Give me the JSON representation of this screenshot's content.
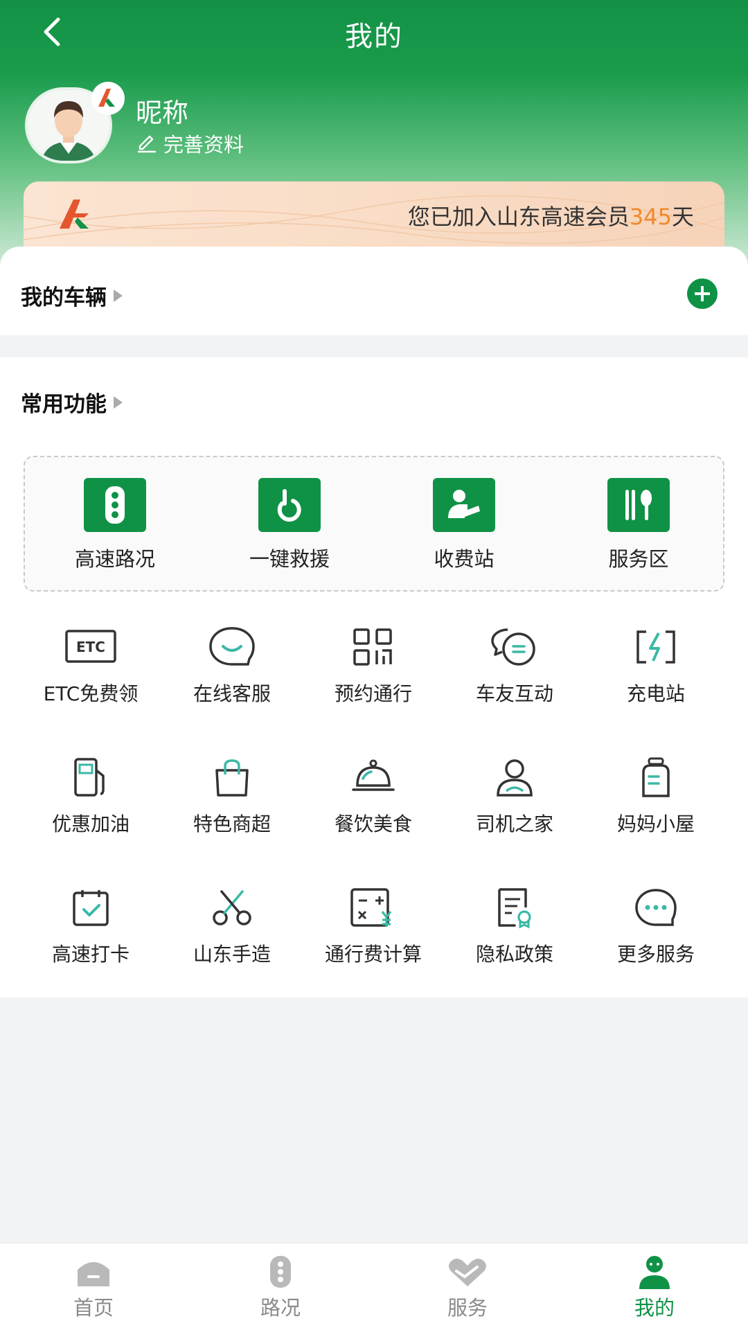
{
  "nav": {
    "title": "我的"
  },
  "profile": {
    "nickname": "昵称",
    "edit_label": "完善资料"
  },
  "member": {
    "text_prefix": "您已加入山东高速会员",
    "days": "345",
    "text_suffix": "天"
  },
  "vehicles": {
    "title": "我的车辆"
  },
  "functions": {
    "title": "常用功能",
    "favorites": [
      {
        "label": "高速路况",
        "icon": "traffic-light-icon"
      },
      {
        "label": "一键救援",
        "icon": "rescue-hook-icon"
      },
      {
        "label": "收费站",
        "icon": "toll-station-icon"
      },
      {
        "label": "服务区",
        "icon": "dining-utensils-icon"
      }
    ],
    "grid": [
      {
        "label": "ETC免费领",
        "icon": "etc-card-icon"
      },
      {
        "label": "在线客服",
        "icon": "chat-bubble-icon"
      },
      {
        "label": "预约通行",
        "icon": "qr-code-icon"
      },
      {
        "label": "车友互动",
        "icon": "chat-bubbles-icon"
      },
      {
        "label": "充电站",
        "icon": "charging-bolt-icon"
      },
      {
        "label": "优惠加油",
        "icon": "fuel-pump-icon"
      },
      {
        "label": "特色商超",
        "icon": "shopping-bag-icon"
      },
      {
        "label": "餐饮美食",
        "icon": "food-cloche-icon"
      },
      {
        "label": "司机之家",
        "icon": "driver-icon"
      },
      {
        "label": "妈妈小屋",
        "icon": "baby-bottle-icon"
      },
      {
        "label": "高速打卡",
        "icon": "calendar-check-icon"
      },
      {
        "label": "山东手造",
        "icon": "scissors-icon"
      },
      {
        "label": "通行费计算",
        "icon": "calculator-icon"
      },
      {
        "label": "隐私政策",
        "icon": "policy-document-icon"
      },
      {
        "label": "更多服务",
        "icon": "more-dots-icon"
      }
    ]
  },
  "tabbar": {
    "tabs": [
      {
        "label": "首页",
        "icon": "home-icon"
      },
      {
        "label": "路况",
        "icon": "traffic-light-icon"
      },
      {
        "label": "服务",
        "icon": "heart-hands-icon"
      },
      {
        "label": "我的",
        "icon": "user-icon"
      }
    ],
    "active": "我的"
  },
  "colors": {
    "brand_green": "#109246",
    "accent_orange": "#f0892a",
    "teal_accent": "#3bb8a6"
  }
}
